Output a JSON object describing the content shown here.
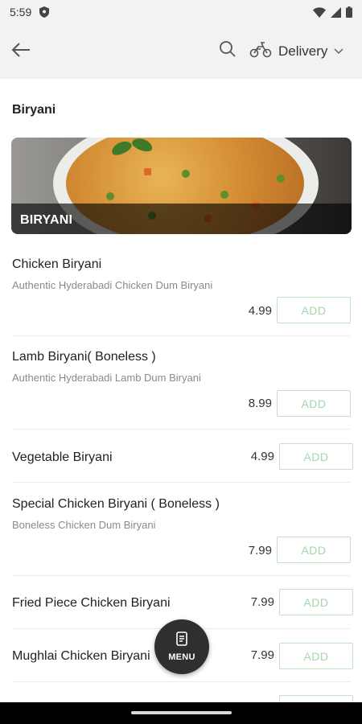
{
  "status_bar": {
    "time": "5:59"
  },
  "header": {
    "delivery_label": "Delivery"
  },
  "section": {
    "title": "Biryani",
    "banner_label": "BIRYANI"
  },
  "items": [
    {
      "name": "Chicken Biryani",
      "description": "Authentic Hyderabadi Chicken Dum Biryani",
      "price": "4.99",
      "add_label": "ADD"
    },
    {
      "name": "Lamb Biryani( Boneless )",
      "description": "Authentic Hyderabadi Lamb Dum Biryani",
      "price": "8.99",
      "add_label": "ADD"
    },
    {
      "name": "Vegetable Biryani",
      "description": "",
      "price": "4.99",
      "add_label": "ADD"
    },
    {
      "name": "Special Chicken Biryani ( Boneless )",
      "description": "Boneless Chicken Dum Biryani",
      "price": "7.99",
      "add_label": "ADD"
    },
    {
      "name": "Fried Piece Chicken Biryani",
      "description": "",
      "price": "7.99",
      "add_label": "ADD"
    },
    {
      "name": "Mughlai Chicken Biryani",
      "description": "",
      "price": "7.99",
      "add_label": "ADD"
    }
  ],
  "menu_button": {
    "label": "MENU"
  },
  "colors": {
    "add_border": "#bfe3c3",
    "add_text": "#a6d6ab",
    "fab": "#2f2f2f",
    "header_bg": "#f2f2f2"
  },
  "icons": [
    "shield-icon",
    "wifi-icon",
    "signal-icon",
    "battery-icon",
    "back-arrow-icon",
    "search-icon",
    "scooter-icon",
    "chevron-down-icon",
    "menu-book-icon"
  ]
}
